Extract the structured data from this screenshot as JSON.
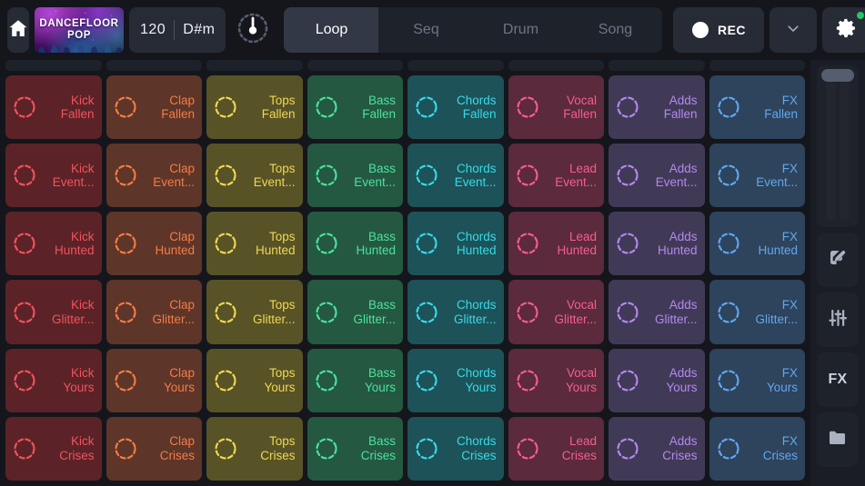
{
  "topbar": {
    "home_icon": "home-icon",
    "artwork": {
      "line1": "DANCEFLOOR",
      "line2": "POP"
    },
    "bpm": "120",
    "key": "D#m",
    "metronome_icon": "metronome-knob-icon",
    "tabs": [
      {
        "label": "Loop",
        "active": true
      },
      {
        "label": "Seq",
        "active": false
      },
      {
        "label": "Drum",
        "active": false
      },
      {
        "label": "Song",
        "active": false
      }
    ],
    "rec": {
      "label": "REC",
      "icon": "record-dot-icon"
    },
    "chevron_icon": "chevron-down-icon",
    "gear_icon": "gear-icon",
    "gear_badge_color": "#27c467"
  },
  "rail": {
    "fader": {
      "icon": "volume-fader-icon"
    },
    "buttons": [
      {
        "name": "edit-button",
        "icon": "edit-pencil-icon",
        "label": ""
      },
      {
        "name": "mixer-button",
        "icon": "mixer-sliders-icon",
        "label": ""
      },
      {
        "name": "fx-button",
        "icon": "fx-text-icon",
        "label": "FX"
      },
      {
        "name": "files-button",
        "icon": "folder-icon",
        "label": ""
      }
    ]
  },
  "grid": {
    "columns": [
      {
        "name": "Kick",
        "bg": "#5b2327",
        "fg": "#f4515d",
        "ring": "#f4515d"
      },
      {
        "name": "Clap",
        "bg": "#5e3529",
        "fg": "#f47c44",
        "ring": "#f47c44"
      },
      {
        "name": "Tops",
        "bg": "#575327",
        "fg": "#f1d750",
        "ring": "#f1d750"
      },
      {
        "name": "Bass",
        "bg": "#245841",
        "fg": "#4ae39a",
        "ring": "#4ae39a"
      },
      {
        "name": "Chords",
        "bg": "#1d5258",
        "fg": "#35dbe8",
        "ring": "#35dbe8"
      },
      {
        "name": "Vocal",
        "bg": "#5b2a3c",
        "fg": "#f75c92",
        "ring": "#f75c92"
      },
      {
        "name": "Adds",
        "bg": "#413a56",
        "fg": "#b388f0",
        "ring": "#b388f0"
      },
      {
        "name": "FX",
        "bg": "#2e435c",
        "fg": "#5fa8f0",
        "ring": "#5fa8f0"
      }
    ],
    "rows": [
      "Fallen",
      "Event...",
      "Hunted",
      "Glitter...",
      "Yours",
      "Crises"
    ],
    "cells": [
      [
        {
          "line1": "Kick",
          "line2": "Fallen"
        },
        {
          "line1": "Clap",
          "line2": "Fallen"
        },
        {
          "line1": "Tops",
          "line2": "Fallen"
        },
        {
          "line1": "Bass",
          "line2": "Fallen"
        },
        {
          "line1": "Chords",
          "line2": "Fallen"
        },
        {
          "line1": "Vocal",
          "line2": "Fallen"
        },
        {
          "line1": "Adds",
          "line2": "Fallen"
        },
        {
          "line1": "FX",
          "line2": "Fallen"
        }
      ],
      [
        {
          "line1": "Kick",
          "line2": "Event..."
        },
        {
          "line1": "Clap",
          "line2": "Event..."
        },
        {
          "line1": "Tops",
          "line2": "Event..."
        },
        {
          "line1": "Bass",
          "line2": "Event..."
        },
        {
          "line1": "Chords",
          "line2": "Event..."
        },
        {
          "line1": "Lead",
          "line2": "Event..."
        },
        {
          "line1": "Adds",
          "line2": "Event..."
        },
        {
          "line1": "FX",
          "line2": "Event..."
        }
      ],
      [
        {
          "line1": "Kick",
          "line2": "Hunted"
        },
        {
          "line1": "Clap",
          "line2": "Hunted"
        },
        {
          "line1": "Tops",
          "line2": "Hunted"
        },
        {
          "line1": "Bass",
          "line2": "Hunted"
        },
        {
          "line1": "Chords",
          "line2": "Hunted"
        },
        {
          "line1": "Lead",
          "line2": "Hunted"
        },
        {
          "line1": "Adds",
          "line2": "Hunted"
        },
        {
          "line1": "FX",
          "line2": "Hunted"
        }
      ],
      [
        {
          "line1": "Kick",
          "line2": "Glitter..."
        },
        {
          "line1": "Clap",
          "line2": "Glitter..."
        },
        {
          "line1": "Tops",
          "line2": "Glitter..."
        },
        {
          "line1": "Bass",
          "line2": "Glitter..."
        },
        {
          "line1": "Chords",
          "line2": "Glitter..."
        },
        {
          "line1": "Vocal",
          "line2": "Glitter..."
        },
        {
          "line1": "Adds",
          "line2": "Glitter..."
        },
        {
          "line1": "FX",
          "line2": "Glitter..."
        }
      ],
      [
        {
          "line1": "Kick",
          "line2": "Yours"
        },
        {
          "line1": "Clap",
          "line2": "Yours"
        },
        {
          "line1": "Tops",
          "line2": "Yours"
        },
        {
          "line1": "Bass",
          "line2": "Yours"
        },
        {
          "line1": "Chords",
          "line2": "Yours"
        },
        {
          "line1": "Vocal",
          "line2": "Yours"
        },
        {
          "line1": "Adds",
          "line2": "Yours"
        },
        {
          "line1": "FX",
          "line2": "Yours"
        }
      ],
      [
        {
          "line1": "Kick",
          "line2": "Crises"
        },
        {
          "line1": "Clap",
          "line2": "Crises"
        },
        {
          "line1": "Tops",
          "line2": "Crises"
        },
        {
          "line1": "Bass",
          "line2": "Crises"
        },
        {
          "line1": "Chords",
          "line2": "Crises"
        },
        {
          "line1": "Lead",
          "line2": "Crises"
        },
        {
          "line1": "Adds",
          "line2": "Crises"
        },
        {
          "line1": "FX",
          "line2": "Crises"
        }
      ]
    ]
  }
}
